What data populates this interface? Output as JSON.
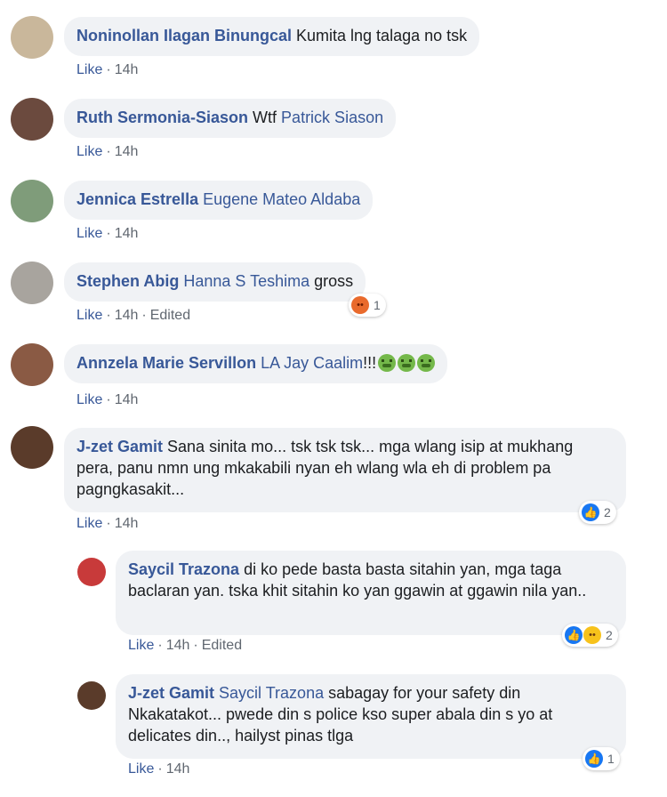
{
  "comments": [
    {
      "author": "Noninollan Ilagan Binungcal",
      "text": "Kumita lng talaga no tsk",
      "like": "Like",
      "time": "14h"
    },
    {
      "author": "Ruth Sermonia-Siason",
      "text": "Wtf",
      "mention": "Patrick Siason",
      "like": "Like",
      "time": "14h"
    },
    {
      "author": "Jennica Estrella",
      "mention": "Eugene Mateo Aldaba",
      "like": "Like",
      "time": "14h"
    },
    {
      "author": "Stephen Abig",
      "mention": "Hanna S Teshima",
      "text": "gross",
      "like": "Like",
      "time": "14h",
      "edited": "Edited",
      "reaction_count": "1"
    },
    {
      "author": "Annzela Marie Servillon",
      "mention": "LA Jay Caalim",
      "text": "!!!",
      "like": "Like",
      "time": "14h"
    },
    {
      "author": "J-zet Gamit",
      "text": "Sana sinita mo... tsk tsk tsk... mga wlang isip at mukhang pera, panu nmn ung mkakabili nyan eh wlang wla eh di problem pa pagngkasakit...",
      "like": "Like",
      "time": "14h",
      "reaction_count": "2"
    },
    {
      "author": "Saycil Trazona",
      "text": "di ko pede basta basta sitahin yan, mga taga baclaran yan. tska khit sitahin ko yan ggawin at ggawin nila yan..",
      "like": "Like",
      "time": "14h",
      "edited": "Edited",
      "reaction_count": "2"
    },
    {
      "author": "J-zet Gamit",
      "mention": "Saycil Trazona",
      "text": "sabagay for your safety din Nkakatakot... pwede din s police kso super abala din s yo at delicates din.., hailyst pinas tlga",
      "like": "Like",
      "time": "14h",
      "reaction_count": "1"
    }
  ],
  "colors": {
    "author": "#385898",
    "bubble": "#f0f2f5",
    "meta": "#606770",
    "like_reaction": "#1877f2",
    "angry_reaction": "#e96a2c"
  },
  "icons": [
    "like-reaction-icon",
    "angry-reaction-icon",
    "haha-reaction-icon",
    "nauseated-face-emoji"
  ]
}
